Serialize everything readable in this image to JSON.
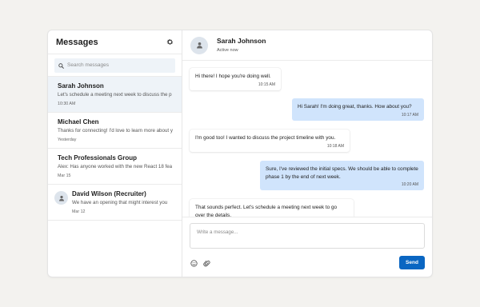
{
  "sidebar": {
    "title": "Messages",
    "search_placeholder": "Search messages",
    "conversations": [
      {
        "name": "Sarah Johnson",
        "preview": "Let's schedule a meeting next week to discuss the p",
        "time": "10:30 AM"
      },
      {
        "name": "Michael Chen",
        "preview": "Thanks for connecting! I'd love to learn more about y",
        "time": "Yesterday"
      },
      {
        "name": "Tech Professionals Group",
        "preview": "Alex: Has anyone worked with the new React 18 fea",
        "time": "Mar 15"
      },
      {
        "name": "David Wilson (Recruiter)",
        "preview": "We have an opening that might interest you",
        "time": "Mar 12"
      }
    ]
  },
  "chat": {
    "name": "Sarah Johnson",
    "status": "Active now",
    "messages": [
      {
        "direction": "in",
        "text": "Hi there! I hope you're doing well.",
        "time": "10:15 AM"
      },
      {
        "direction": "out",
        "text": "Hi Sarah! I'm doing great, thanks. How about you?",
        "time": "10:17 AM"
      },
      {
        "direction": "in",
        "text": "I'm good too! I wanted to discuss the project timeline with you.",
        "time": "10:18 AM"
      },
      {
        "direction": "out",
        "text": "Sure, I've reviewed the initial specs. We should be able to complete phase 1 by the end of next week.",
        "time": "10:20 AM"
      },
      {
        "direction": "in",
        "text": "That sounds perfect. Let's schedule a meeting next week to go over the details.",
        "time": ""
      }
    ],
    "composer_placeholder": "Write a message...",
    "send_label": "Send"
  },
  "colors": {
    "accent": "#0a66c2",
    "outgoing_bubble": "#d0e4fc",
    "active_row": "#eef3f8"
  },
  "icons": [
    "gear-icon",
    "search-icon",
    "user-avatar-icon",
    "emoji-icon",
    "paperclip-icon"
  ]
}
